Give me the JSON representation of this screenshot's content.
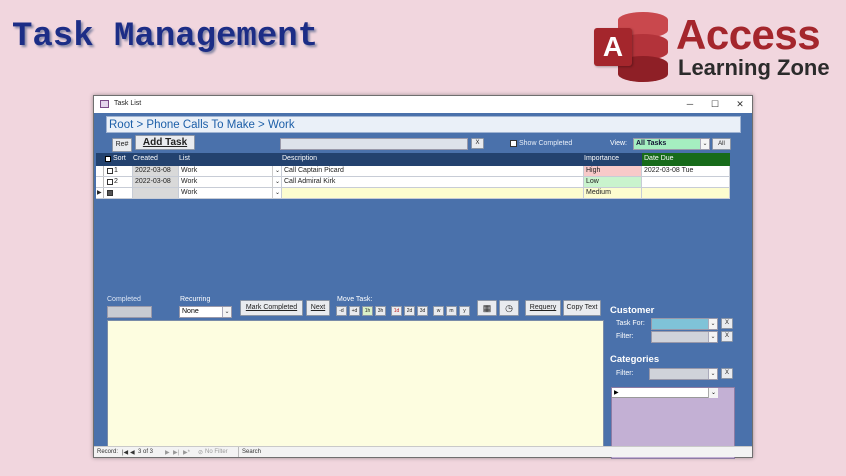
{
  "slide": {
    "title": "Task Management"
  },
  "logo": {
    "letter": "A",
    "line1": "Access",
    "line2": "Learning Zone"
  },
  "window": {
    "title": "Task List",
    "min": "─",
    "max": "☐",
    "close": "✕"
  },
  "breadcrumb": "Root > Phone Calls To Make > Work",
  "toolbar": {
    "ref_label": "Re#",
    "add_task_label": "Add Task",
    "clear_x": "X",
    "show_completed_label": "Show Completed",
    "view_label": "View:",
    "view_value": "All Tasks",
    "all_label": "All"
  },
  "grid": {
    "columns": [
      "Sort",
      "Created",
      "List",
      "Description",
      "Importance",
      "Date Due"
    ],
    "rows": [
      {
        "sort": "1",
        "created": "2022-03-08",
        "list": "Work",
        "description": "Call Captain Picard",
        "importance": "High",
        "due": "2022-03-08 Tue"
      },
      {
        "sort": "2",
        "created": "2022-03-08",
        "list": "Work",
        "description": "Call Admiral Kirk",
        "importance": "Low",
        "due": ""
      },
      {
        "sort": "",
        "created": "",
        "list": "Work",
        "description": "",
        "importance": "Medium",
        "due": ""
      }
    ]
  },
  "detail": {
    "completed_label": "Completed",
    "recurring_label": "Recurring",
    "recurring_value": "None",
    "mark_completed": "Mark Completed",
    "next": "Next",
    "move_task_label": "Move Task:",
    "move_buttons": [
      "-d",
      "+d",
      "1h",
      "3h",
      "1d",
      "2d",
      "3d",
      "w",
      "m",
      "y"
    ],
    "requery": "Requery",
    "copy_text": "Copy Text"
  },
  "customer": {
    "heading": "Customer",
    "task_for_label": "Task For:",
    "filter_label": "Filter:",
    "x": "X"
  },
  "categories": {
    "heading": "Categories",
    "filter_label": "Filter:",
    "x": "X"
  },
  "statusbar": {
    "record_label": "Record:",
    "record_pos": "3 of 3",
    "no_filter": "No Filter",
    "search": "Search"
  }
}
